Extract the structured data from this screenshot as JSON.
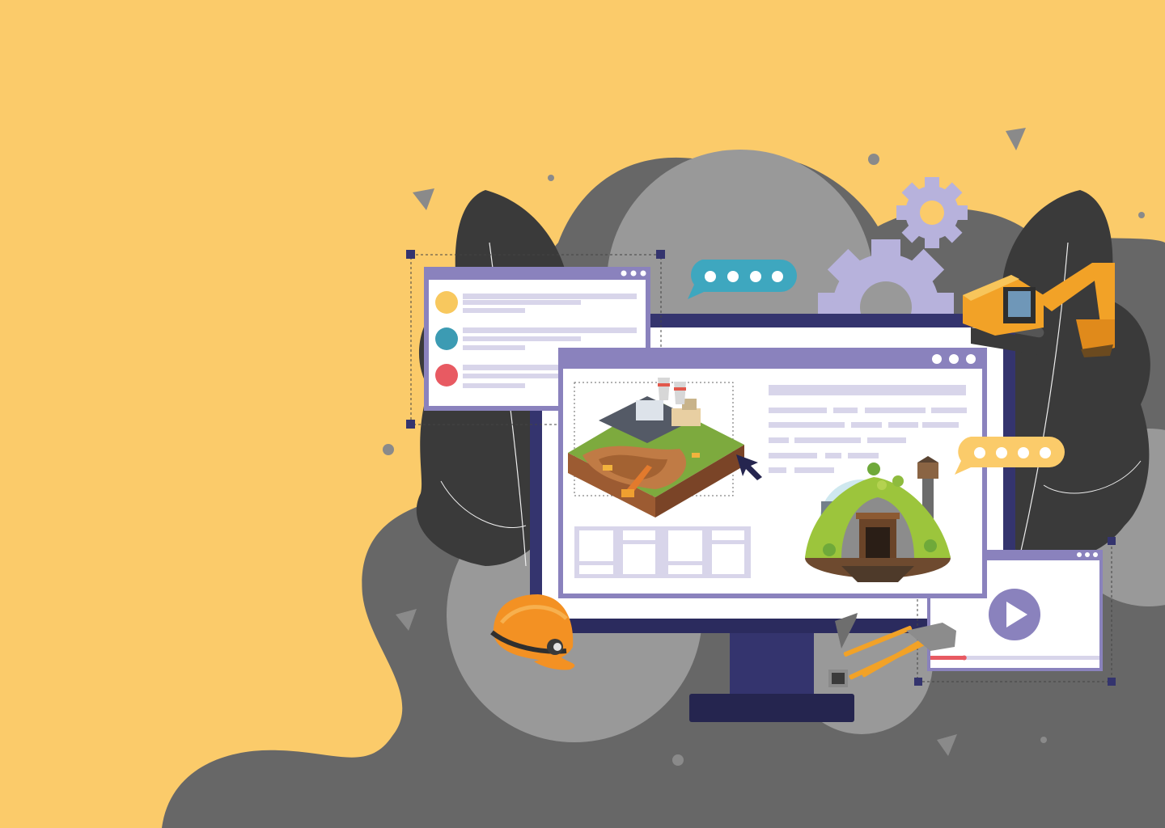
{
  "scene": {
    "type": "illustration",
    "theme": "mining software on desktop monitor",
    "text_content": []
  },
  "colors": {
    "background": "#FBCB6A",
    "blob_dark": "#666666",
    "blob_light": "#999999",
    "leaf": "#3A3A3A",
    "monitor_frame": "#34346E",
    "window_frame": "#8A82BD",
    "placeholder_line": "#D8D5EA",
    "gear": "#B7B2DC",
    "chat_teal": "#3EA7BF",
    "chat_yellow": "#FBCB6A",
    "dot_yellow": "#F8C85E",
    "dot_teal": "#3C9BB3",
    "dot_red": "#E85A62",
    "play_button": "#8A82BD",
    "progress_red": "#E85A62",
    "helmet": "#F39123",
    "excavator": "#F2A227"
  },
  "icons": {
    "gear_large": "gear-icon",
    "gear_small": "gear-icon",
    "chat_teal": "chat-bubble-icon",
    "chat_yellow": "chat-bubble-icon",
    "cursor": "cursor-arrow-icon",
    "play": "play-icon",
    "helmet": "mining-helmet-icon",
    "pickaxe": "pickaxe-icon",
    "hammer": "hammer-icon",
    "shovel": "shovel-icon",
    "excavator": "excavator-icon",
    "mine_plant": "open-pit-mine-icon",
    "mine_entrance": "mine-entrance-icon"
  },
  "media_player": {
    "progress_fraction": 0.2
  }
}
